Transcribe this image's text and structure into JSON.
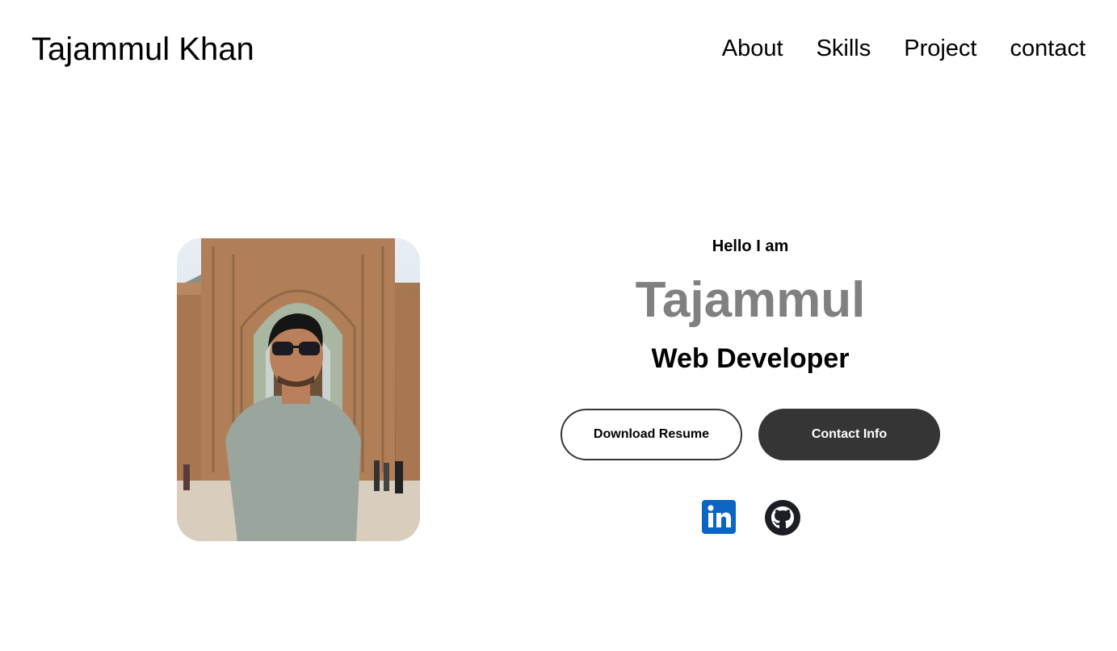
{
  "header": {
    "logo": "Tajammul Khan",
    "nav": [
      {
        "label": "About"
      },
      {
        "label": "Skills"
      },
      {
        "label": "Project"
      },
      {
        "label": "contact"
      }
    ]
  },
  "hero": {
    "greeting": "Hello I am",
    "name": "Tajammul",
    "role": "Web Developer",
    "buttons": {
      "download_label": "Download Resume",
      "contact_label": "Contact Info"
    },
    "socials": [
      {
        "icon": "linkedin-icon",
        "color": "#0a66c2"
      },
      {
        "icon": "github-icon",
        "color": "#1b1f23"
      }
    ],
    "colors": {
      "name": "#808080",
      "button_dark": "#353535"
    }
  }
}
